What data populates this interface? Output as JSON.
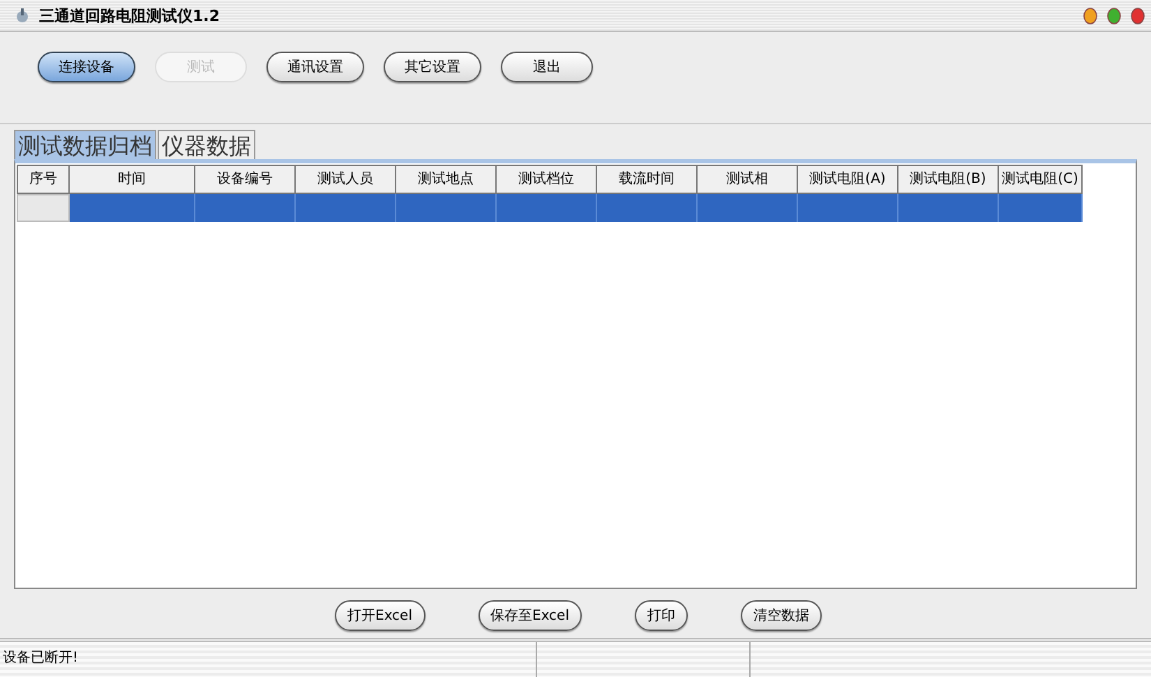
{
  "window": {
    "title": "三通道回路电阻测试仪1.2"
  },
  "toolbar": [
    {
      "label": "连接设备",
      "default": true,
      "disabled": false
    },
    {
      "label": "测试",
      "default": false,
      "disabled": true
    },
    {
      "label": "通讯设置",
      "default": false,
      "disabled": false
    },
    {
      "label": "其它设置",
      "default": false,
      "disabled": false
    },
    {
      "label": "退出",
      "default": false,
      "disabled": false
    }
  ],
  "tabs": [
    {
      "label": "测试数据归档",
      "selected": true
    },
    {
      "label": "仪器数据",
      "selected": false
    }
  ],
  "table": {
    "columns": [
      "序号",
      "时间",
      "设备编号",
      "测试人员",
      "测试地点",
      "测试档位",
      "载流时间",
      "测试相",
      "测试电阻(A)",
      "测试电阻(B)",
      "测试电阻(C)"
    ],
    "rows": [
      {
        "selected": true
      }
    ]
  },
  "actions": [
    {
      "label": "打开Excel"
    },
    {
      "label": "保存至Excel"
    },
    {
      "label": "打印"
    },
    {
      "label": "清空数据"
    }
  ],
  "status_bar": {
    "message": "设备已断开!"
  }
}
